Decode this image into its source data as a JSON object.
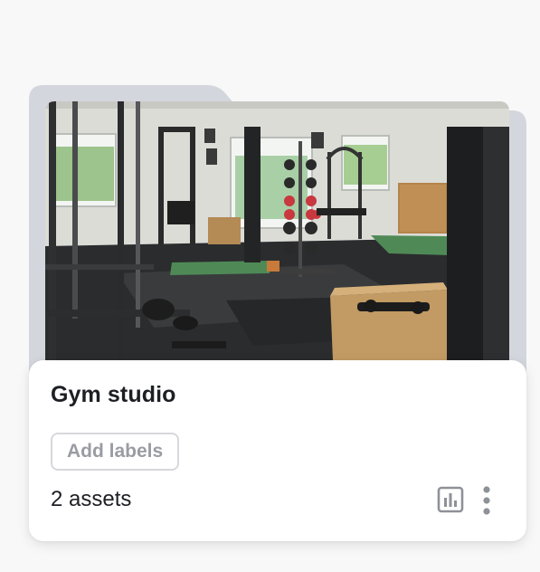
{
  "folder": {
    "title": "Gym studio",
    "add_labels_label": "Add labels",
    "asset_count": "2 assets",
    "thumbnail_description": "gym-interior-photo",
    "stats_icon": "bar-chart-icon",
    "more_icon": "vertical-ellipsis-icon"
  },
  "colors": {
    "page_background": "#f8f8f9",
    "folder_tab": "#d3d6dc",
    "panel": "#ffffff",
    "title_text": "#1e1f24",
    "muted_text": "#9a9ca3",
    "icon": "#8f9198"
  }
}
